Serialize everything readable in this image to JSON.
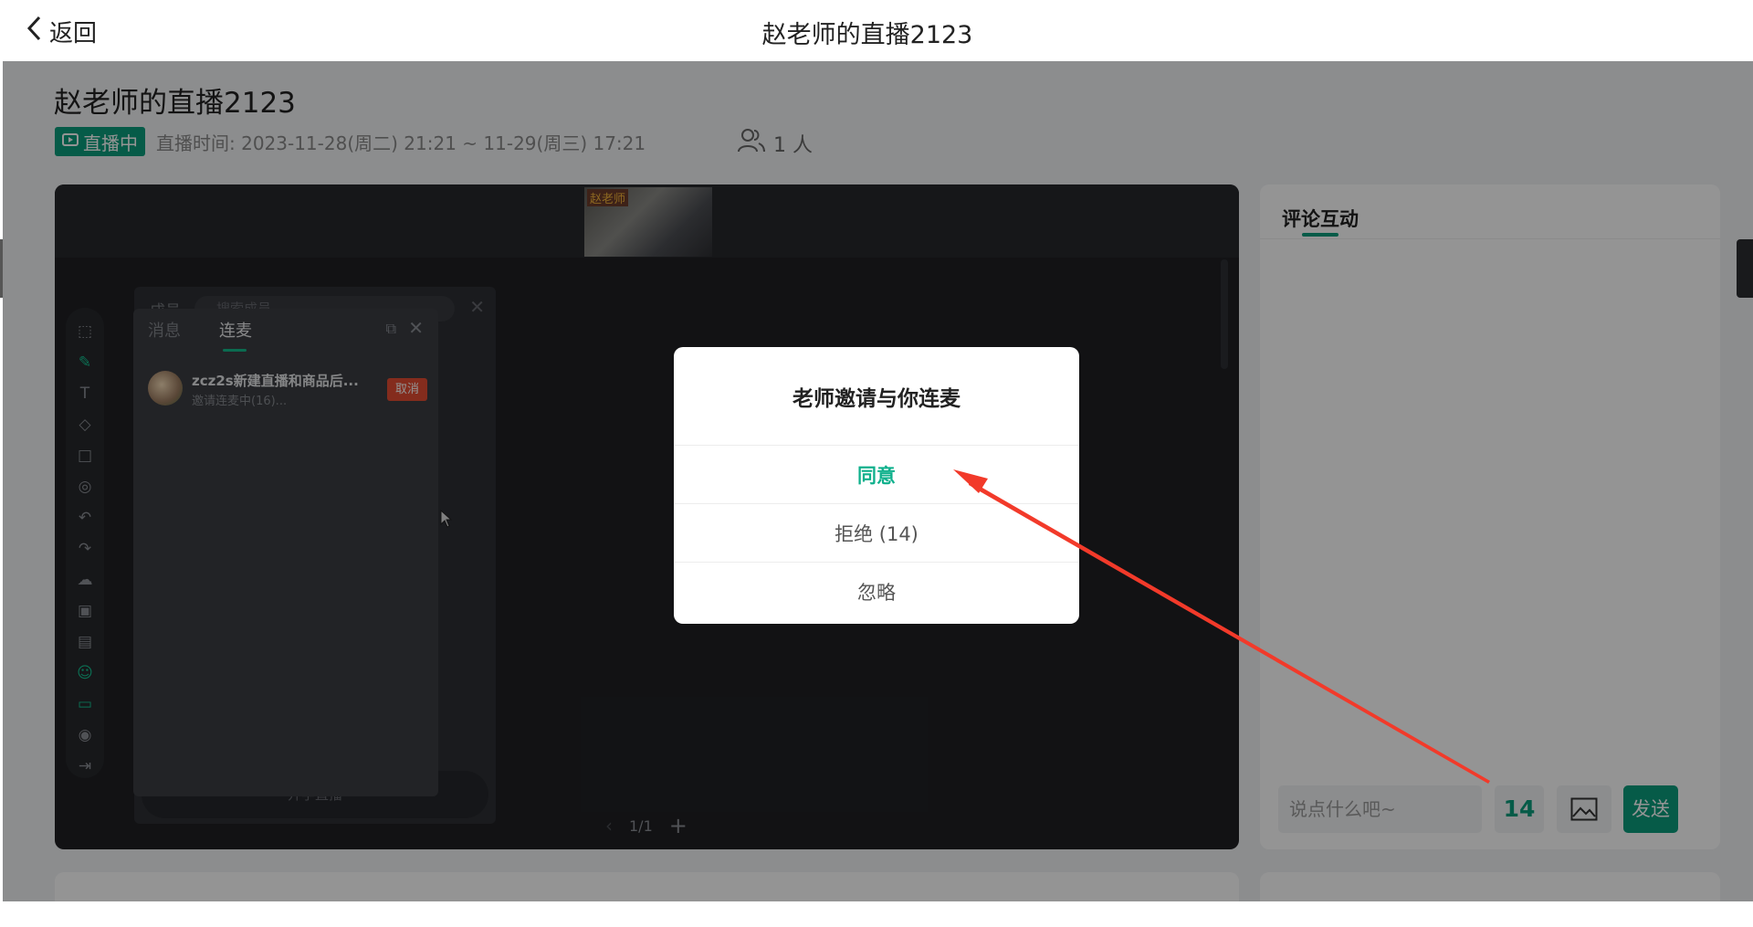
{
  "header": {
    "back_label": "返回",
    "title": "赵老师的直播2123"
  },
  "live": {
    "title": "赵老师的直播2123",
    "status_badge": "直播中",
    "time_text": "直播时间: 2023-11-28(周二) 21:21 ~ 11-29(周三) 17:21",
    "viewer_count": "1 人"
  },
  "stage": {
    "thumb_label": "赵老师",
    "member_panel": {
      "title": "成员",
      "search_placeholder": "搜索成员",
      "bottom_button": "开学直播"
    },
    "message_panel": {
      "tabs": [
        "消息",
        "连麦"
      ],
      "active_tab": "连麦",
      "request": {
        "name": "zcz2s新建直播和商品后...",
        "status": "邀请连麦中(16)...",
        "cancel_label": "取消"
      }
    },
    "pager": {
      "page": "1/1"
    }
  },
  "comments": {
    "title": "评论互动",
    "input_placeholder": "说点什么吧~",
    "count": "14",
    "send_label": "发送"
  },
  "dialog": {
    "title": "老师邀请与你连麦",
    "agree_label": "同意",
    "reject_label": "拒绝 (14)",
    "ignore_label": "忽略"
  },
  "colors": {
    "accent": "#0c9d7c",
    "danger": "#e34d32",
    "annotation_arrow": "#f23a2a"
  },
  "icons": [
    "chevron-left-icon",
    "live-tv-icon",
    "users-icon",
    "image-icon",
    "search-icon",
    "close-icon",
    "popout-icon",
    "cursor-icon"
  ]
}
